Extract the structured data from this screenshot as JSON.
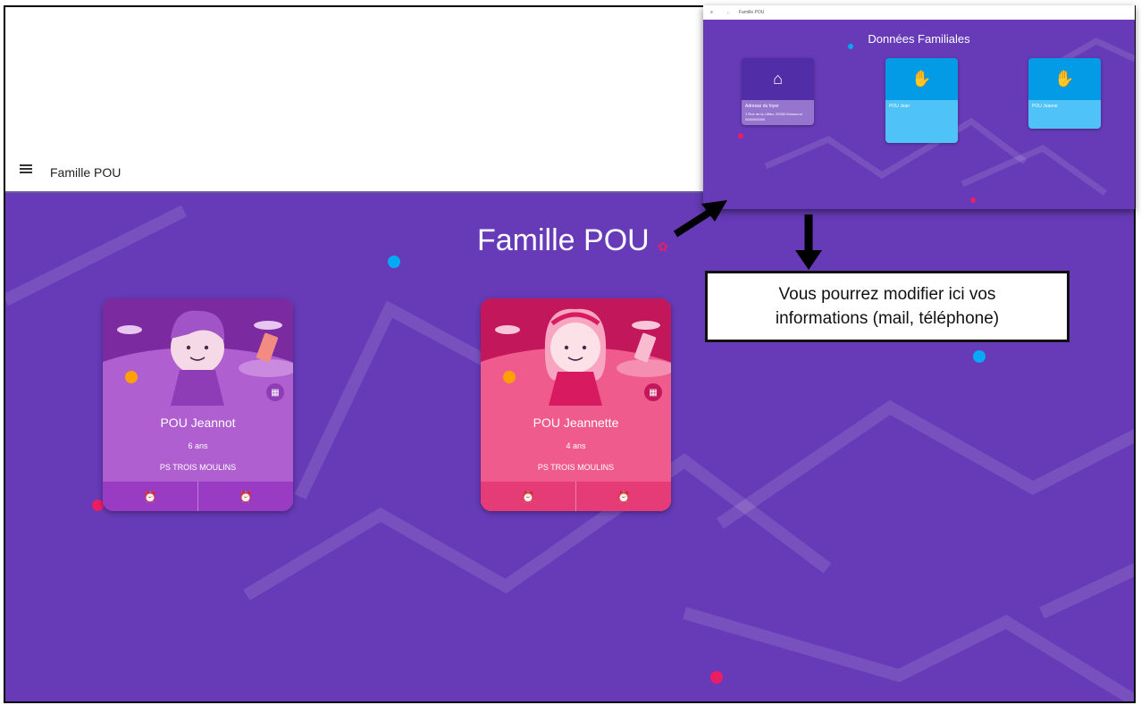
{
  "appbar": {
    "title": "Famille POU"
  },
  "main": {
    "family_title": "Famille POU"
  },
  "cards": [
    {
      "name": "POU Jeannot",
      "age": "6 ans",
      "school": "PS TROIS MOULINS",
      "theme": "#b05fd0"
    },
    {
      "name": "POU Jeannette",
      "age": "4 ans",
      "school": "PS TROIS MOULINS",
      "theme": "#ef5b8d"
    }
  ],
  "screenshot": {
    "tab_title": "Famille POU",
    "heading": "Données Familiales",
    "cards": [
      {
        "title": "Adresse du foyer",
        "detail": "1 Rue de la Liffiez, 00000 Mouscron 0000000000",
        "color": "#7e57c2"
      },
      {
        "title": "POU Jean",
        "detail": "",
        "color": "#29b6f6"
      },
      {
        "title": "POU Jeanne",
        "detail": "",
        "color": "#29b6f6"
      }
    ]
  },
  "callout": {
    "line1": "Vous pourrez modifier ici vos",
    "line2": "informations (mail, téléphone)"
  },
  "colors": {
    "background": "#673ab7",
    "accent_pink": "#e91e63",
    "accent_blue": "#03a9f4"
  }
}
